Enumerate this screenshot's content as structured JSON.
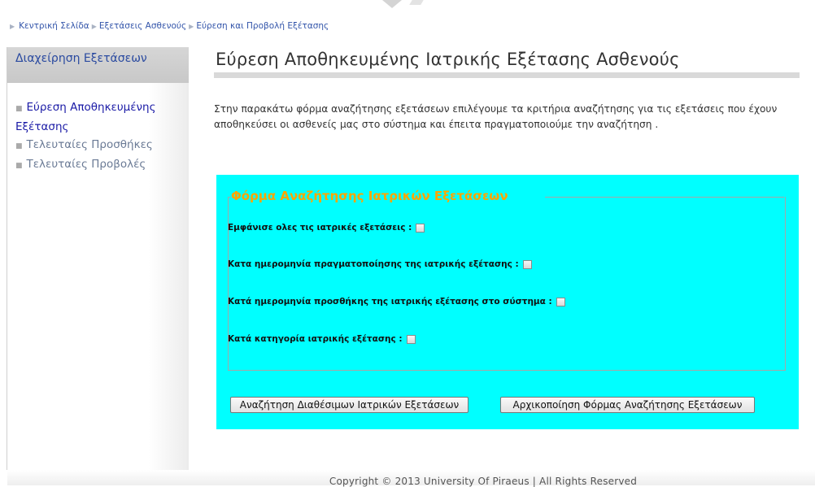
{
  "breadcrumb": {
    "items": [
      "Κεντρική Σελίδα",
      "Εξετάσεις Ασθενούς",
      "Εύρεση και Προβολή Εξέτασης"
    ]
  },
  "sidebar": {
    "title": "Διαχείρηση Εξετάσεων",
    "items": [
      {
        "label": "Εύρεση Αποθηκευμένης Εξέτασης",
        "active": true
      },
      {
        "label": "Τελευταίες Προσθήκες",
        "active": false
      },
      {
        "label": "Τελευταίες Προβολές",
        "active": false
      }
    ]
  },
  "main": {
    "title": "Εύρεση Αποθηκευμένης Ιατρικής Εξέτασης Ασθενούς",
    "intro": "Στην παρακάτω φόρμα αναζήτησης εξετάσεων επιλέγουμε τα κριτήρια αναζήτησης για τις εξετάσεις που έχουν αποθηκεύσει οι ασθενείς μας στο σύστημα και έπειτα πραγματοποιούμε την αναζήτηση ."
  },
  "form": {
    "legend": "Φόρμα Αναζήτησης Ιατρικών Εξετάσεων",
    "options": [
      {
        "label": "Εμφάνισε ολες τις ιατρικές εξετάσεις :",
        "checked": false
      },
      {
        "label": "Κατα ημερομηνία πραγματοποίησης της ιατρικής εξέτασης :",
        "checked": false
      },
      {
        "label": "Κατά ημερομηνία προσθήκης της ιατρικής εξέτασης στο σύστημα :",
        "checked": false
      },
      {
        "label": "Κατά κατηγορία ιατρικής εξέτασης :",
        "checked": false
      }
    ],
    "search_button": "Αναζήτηση Διαθέσιμων Ιατρικών Εξετάσεων",
    "reset_button": "Αρχικοποίηση Φόρμας Αναζήτησης Εξετάσεων"
  },
  "footer": {
    "text": "Copyright © 2013 University Of Piraeus | All Rights Reserved"
  },
  "colors": {
    "panel": "#00ffff",
    "legend": "#ffa500",
    "link": "#2a4aa0"
  }
}
